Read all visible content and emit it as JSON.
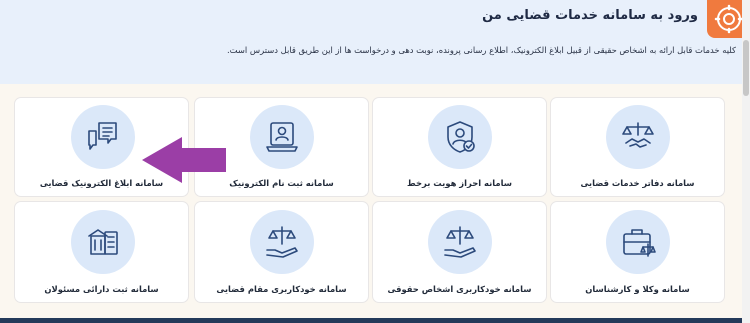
{
  "header": {
    "title": "ورود به سامانه خدمات قضایی من",
    "description": "کلیه خدمات قابل ارائه به اشخاص حقیقی از قبیل ابلاغ الکترونیک، اطلاع رسانی پرونده، نوبت دهی و درخواست ها از این طریق قابل دسترس است.",
    "logo_icon": "gear-icon"
  },
  "services": [
    {
      "label": "سامانه دفاتر خدمات قضایی",
      "icon": "handshake-scales-icon"
    },
    {
      "label": "سامانه احراز هویت برخط",
      "icon": "shield-user-icon"
    },
    {
      "label": "سامانه ثبت نام الکترونیک",
      "icon": "laptop-user-icon"
    },
    {
      "label": "سامانه ابلاغ الکترونیک قضایی",
      "icon": "chat-bubbles-icon"
    },
    {
      "label": "سامانه وکلا و کارشناسان",
      "icon": "briefcase-scales-icon"
    },
    {
      "label": "سامانه خودکاربری اشخاص حقوقی",
      "icon": "hand-scales-icon"
    },
    {
      "label": "سامانه خودکاربری مقام قضایی",
      "icon": "hand-scales-icon"
    },
    {
      "label": "سامانه ثبت دارائی مسئولان",
      "icon": "building-checklist-icon"
    }
  ],
  "colors": {
    "accent": "#f07a3e",
    "icon": "#2c4a7c",
    "arrow": "#9b3ea6"
  }
}
